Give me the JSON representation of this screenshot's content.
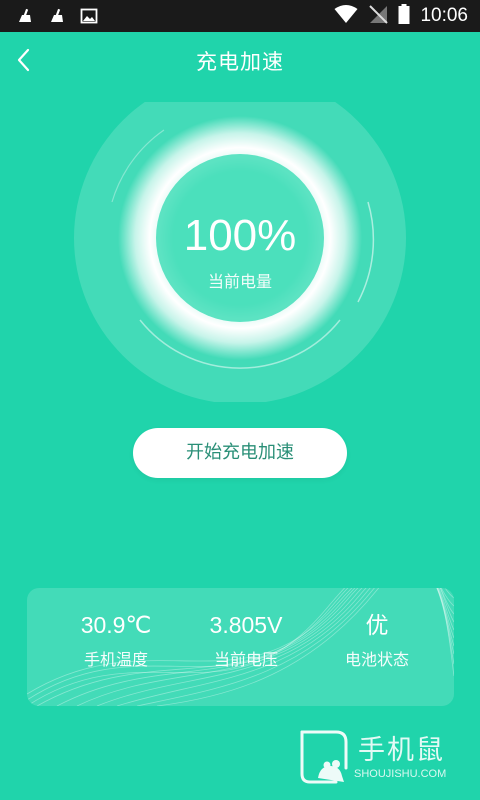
{
  "status_bar": {
    "time": "10:06",
    "icons_left": [
      "broom-icon",
      "broom-icon",
      "image-icon"
    ],
    "icons_right": [
      "wifi-icon",
      "no-sim-icon",
      "battery-icon"
    ]
  },
  "header": {
    "title": "充电加速",
    "back_icon": "chevron-left-icon"
  },
  "gauge": {
    "value": "100%",
    "label": "当前电量",
    "level_fraction": 1.0
  },
  "action": {
    "accelerate_label": "开始充电加速"
  },
  "stats": [
    {
      "value": "30.9℃",
      "label": "手机温度"
    },
    {
      "value": "3.805V",
      "label": "当前电压"
    },
    {
      "value": "优",
      "label": "电池状态"
    }
  ],
  "watermark": {
    "logo": "手机鼠",
    "site": "SHOUJISHU.COM"
  },
  "colors": {
    "background": "#20d4ab",
    "button_text": "#2a8f77",
    "status_bar": "#1a1a1a"
  }
}
